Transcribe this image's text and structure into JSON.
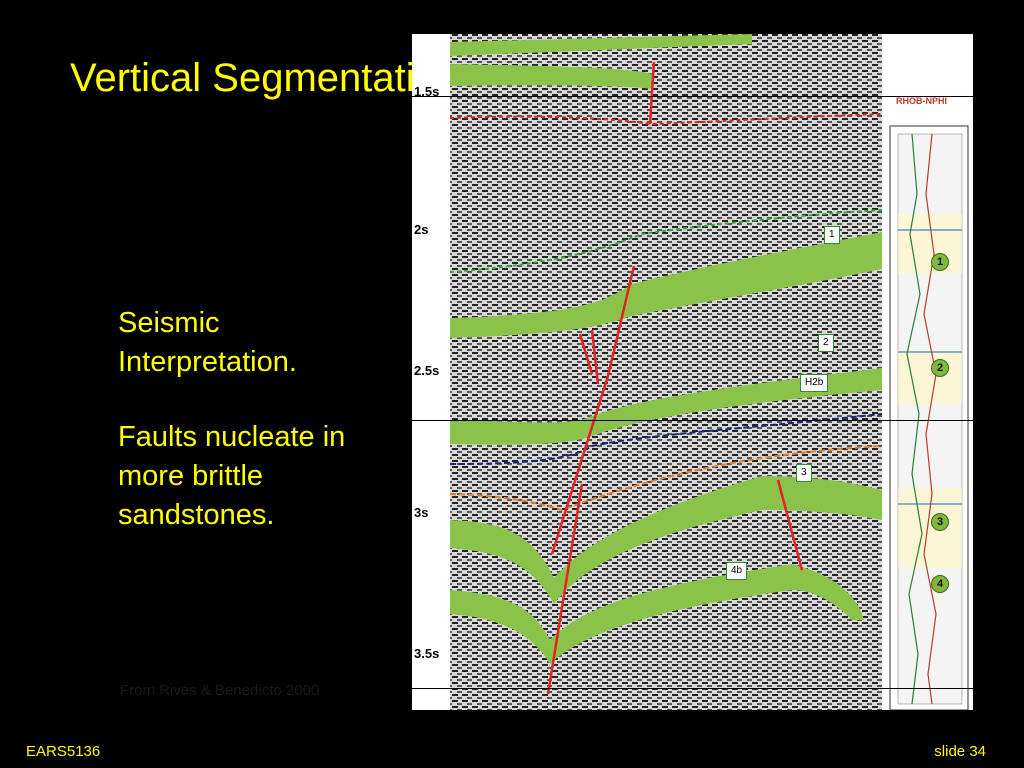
{
  "slide": {
    "title": "Vertical Segmentation",
    "bullets": [
      "Seismic Interpretation.",
      "Faults nucleate in more brittle sandstones."
    ],
    "caption": "From Rives & Benedicto 2000",
    "footer_left": "EARS5136",
    "footer_right": "slide 34"
  },
  "figure": {
    "time_axis_labels": [
      "1.5s",
      "2s",
      "2.5s",
      "3s",
      "3.5s"
    ],
    "horizon_tags": [
      "1",
      "2",
      "H2b",
      "3",
      "4b"
    ],
    "well_log_header": "RHOB-NPHI",
    "zone_markers": [
      "1",
      "2",
      "3",
      "4"
    ]
  },
  "colors": {
    "text_accent": "#ffff00",
    "background": "#000000",
    "sandstone_fill": "#8bc34a",
    "fault_line": "#e52222"
  }
}
